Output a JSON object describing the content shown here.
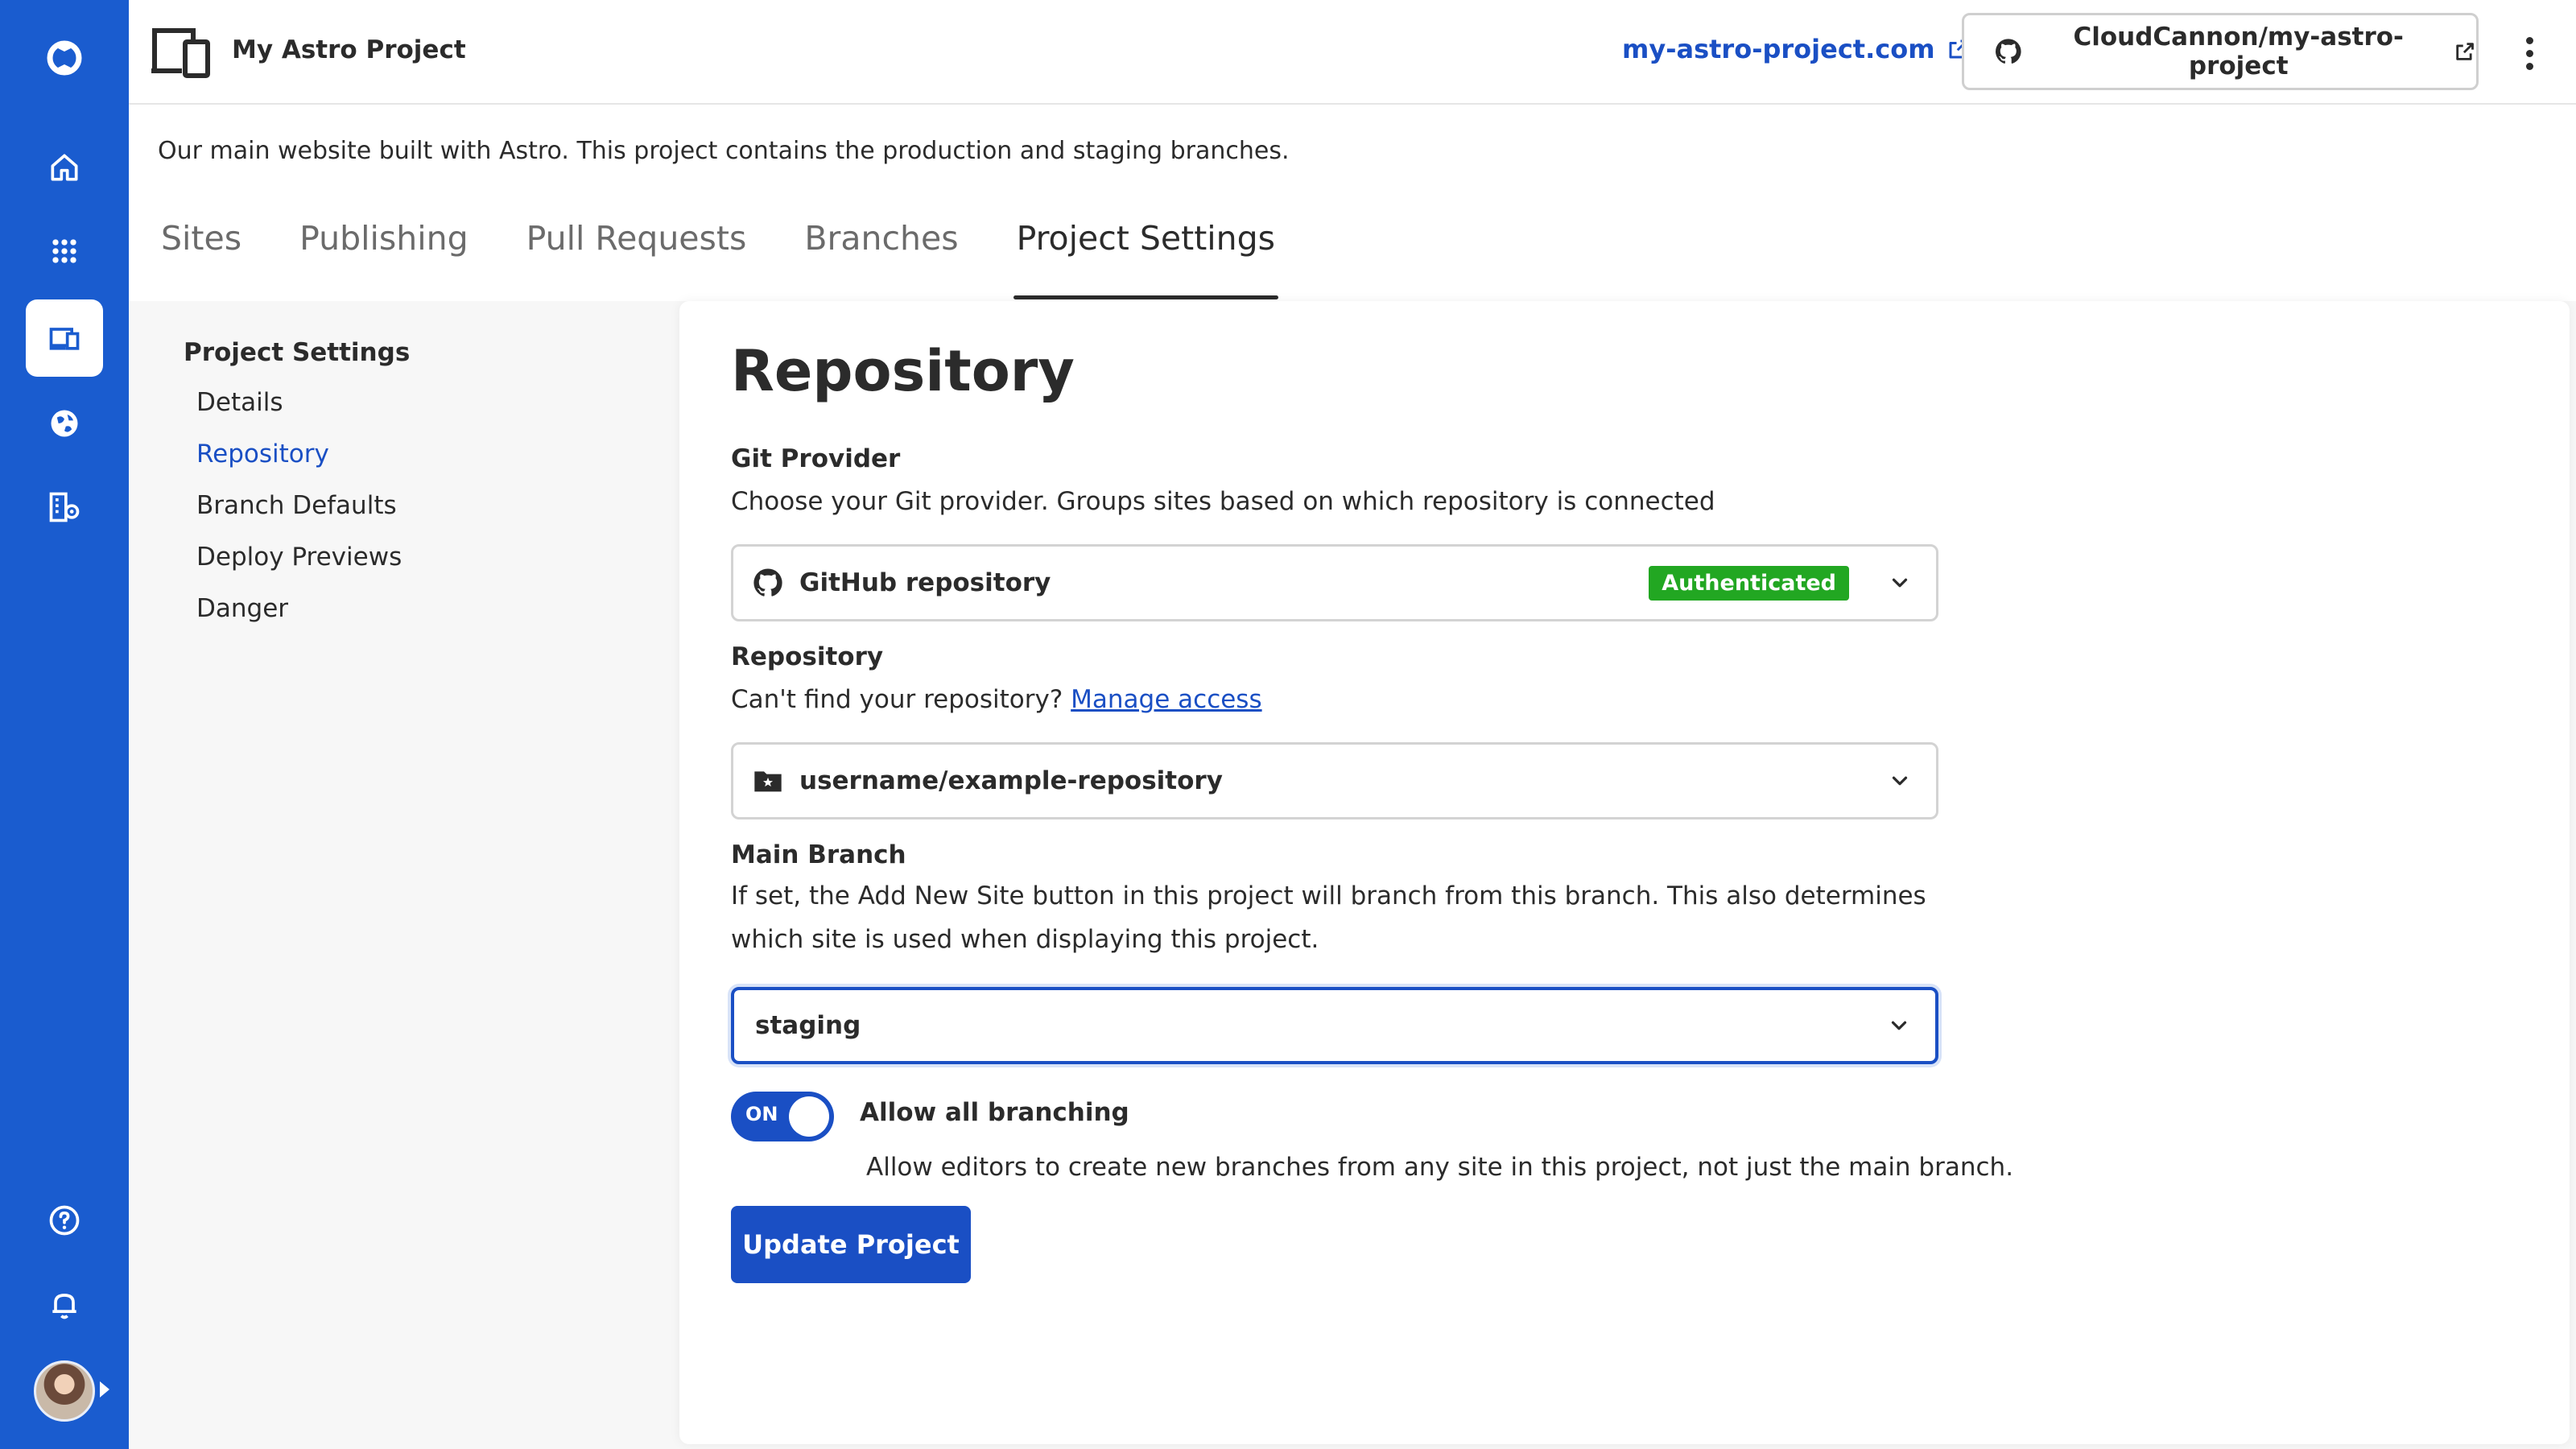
{
  "header": {
    "project_title": "My Astro Project",
    "site_link": "my-astro-project.com",
    "repo_button": "CloudCannon/my-astro-project"
  },
  "description": "Our main website built with Astro. This project contains the production and staging branches.",
  "tabs": [
    {
      "label": "Sites"
    },
    {
      "label": "Publishing"
    },
    {
      "label": "Pull Requests"
    },
    {
      "label": "Branches"
    },
    {
      "label": "Project Settings",
      "active": true
    }
  ],
  "settings_nav": {
    "heading": "Project Settings",
    "items": [
      {
        "label": "Details"
      },
      {
        "label": "Repository",
        "active": true
      },
      {
        "label": "Branch Defaults"
      },
      {
        "label": "Deploy Previews"
      },
      {
        "label": "Danger"
      }
    ]
  },
  "panel": {
    "title": "Repository",
    "git_provider": {
      "label": "Git Provider",
      "help": "Choose your Git provider. Groups sites based on which repository is connected",
      "value": "GitHub repository",
      "badge": "Authenticated"
    },
    "repository": {
      "label": "Repository",
      "help_prefix": "Can't find your repository?",
      "help_link": "Manage access",
      "value": "username/example-repository"
    },
    "main_branch": {
      "label": "Main Branch",
      "help": "If set, the Add New Site button in this project will branch from this branch. This also determines which site is used when displaying this project.",
      "value": "staging"
    },
    "branching_toggle": {
      "state_label": "ON",
      "title": "Allow all branching",
      "help": "Allow editors to create new branches from any site in this project, not just the main branch."
    },
    "update_button": "Update Project"
  },
  "colors": {
    "rail": "#1a5ccf",
    "accent": "#1a4fc4",
    "success": "#22a722"
  },
  "icons": {
    "rail": [
      "cloudcannon-logo-icon",
      "home-icon",
      "apps-grid-icon",
      "projects-icon",
      "globe-icon",
      "organization-icon",
      "help-icon",
      "bell-icon"
    ],
    "header": [
      "devices-icon",
      "external-link-icon",
      "github-icon"
    ]
  }
}
